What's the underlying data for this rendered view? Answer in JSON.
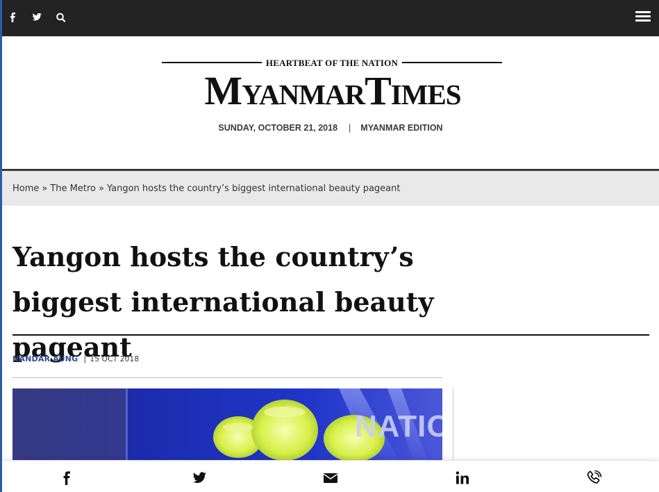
{
  "topbar": {
    "icons": [
      "facebook-icon",
      "twitter-icon",
      "search-icon",
      "menu-icon"
    ],
    "background": "#232323"
  },
  "masthead": {
    "tagline": "HEARTBEAT OF THE NATION",
    "logo": "MyanmarTimes",
    "date": "SUNDAY, OCTOBER 21, 2018",
    "separator": "|",
    "edition": "MYANMAR EDITION"
  },
  "breadcrumb": {
    "items": [
      "Home",
      "The Metro",
      "Yangon hosts the country’s biggest international beauty pageant"
    ],
    "separator": "»"
  },
  "article": {
    "headline": "Yangon hosts the country’s biggest international beauty pageant",
    "author": "NANDAR AUNG",
    "byline_separator": "|",
    "date": "15 OCT 2018",
    "image_text": "NATIO"
  },
  "sharebar": {
    "icons": [
      "facebook-icon",
      "twitter-icon",
      "email-icon",
      "linkedin-icon",
      "phone-icon"
    ]
  },
  "colors": {
    "accent": "#2f5aa8",
    "author": "#2f4d93",
    "breadcrumb_bg": "#e9e9e9"
  }
}
